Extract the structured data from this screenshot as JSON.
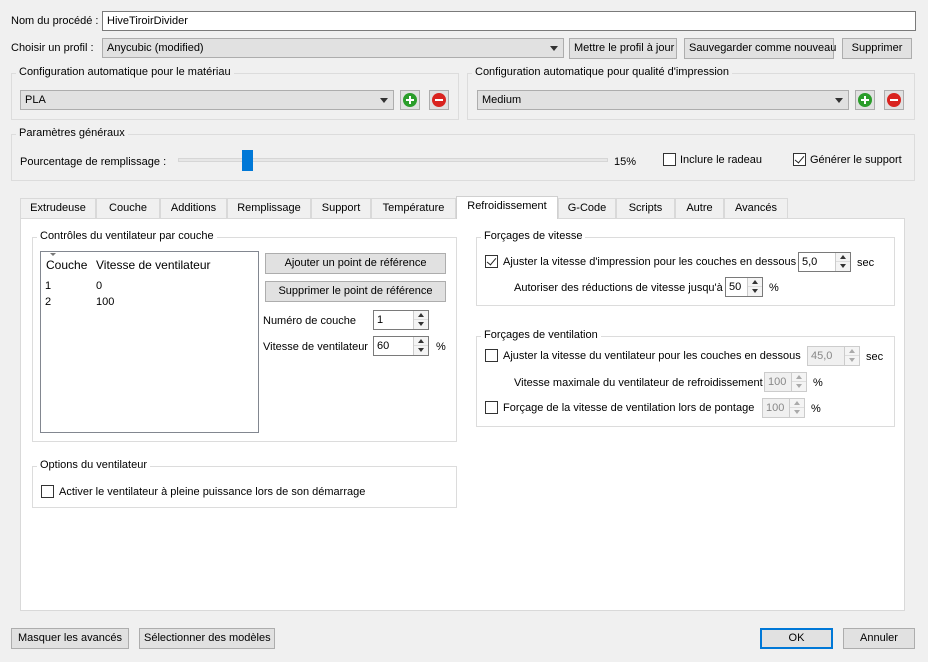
{
  "process": {
    "name_label": "Nom du procédé :",
    "name_value": "HiveTiroirDivider",
    "profile_label": "Choisir un profil :",
    "profile_value": "Anycubic (modified)",
    "update_profile": "Mettre le profil à jour",
    "save_as_new": "Sauvegarder comme nouveau",
    "delete": "Supprimer"
  },
  "material": {
    "title": "Configuration automatique pour le matériau",
    "value": "PLA"
  },
  "quality": {
    "title": "Configuration automatique pour qualité d'impression",
    "value": "Medium"
  },
  "general": {
    "title": "Paramètres généraux",
    "infill_label": "Pourcentage de remplissage :",
    "infill_value": "15%",
    "infill_percent": 15,
    "raft_label": "Inclure le radeau",
    "raft_checked": false,
    "support_label": "Générer le support",
    "support_checked": true
  },
  "tabs": [
    {
      "label": "Extrudeuse"
    },
    {
      "label": "Couche"
    },
    {
      "label": "Additions"
    },
    {
      "label": "Remplissage"
    },
    {
      "label": "Support"
    },
    {
      "label": "Température"
    },
    {
      "label": "Refroidissement",
      "active": true
    },
    {
      "label": "G-Code"
    },
    {
      "label": "Scripts"
    },
    {
      "label": "Autre"
    },
    {
      "label": "Avancés"
    }
  ],
  "fan_controls": {
    "title": "Contrôles du ventilateur par couche",
    "col_layer": "Couche",
    "col_speed": "Vitesse de ventilateur",
    "rows": [
      {
        "layer": "1",
        "speed": "0"
      },
      {
        "layer": "2",
        "speed": "100"
      }
    ],
    "add_point": "Ajouter un point de référence",
    "remove_point": "Supprimer le point de référence",
    "layer_num_label": "Numéro de couche",
    "layer_num_value": "1",
    "fan_speed_label": "Vitesse de ventilateur",
    "fan_speed_value": "60",
    "fan_speed_unit": "%"
  },
  "fan_options": {
    "title": "Options du ventilateur",
    "blip_label": "Activer le ventilateur à pleine puissance lors de son démarrage",
    "blip_checked": false
  },
  "speed_overrides": {
    "title": "Forçages de vitesse",
    "adjust_label": "Ajuster la vitesse d'impression pour les couches en dessous",
    "adjust_checked": true,
    "adjust_value": "5,0",
    "adjust_unit": "sec",
    "allow_label": "Autoriser des réductions de vitesse jusqu'à",
    "allow_value": "50",
    "allow_unit": "%"
  },
  "fan_overrides": {
    "title": "Forçages de ventilation",
    "adjust_label": "Ajuster la vitesse du ventilateur pour les couches en dessous",
    "adjust_checked": false,
    "adjust_value": "45,0",
    "adjust_unit": "sec",
    "max_label": "Vitesse maximale du ventilateur de refroidissement",
    "max_value": "100",
    "max_unit": "%",
    "bridge_label": "Forçage de la vitesse de ventilation lors de pontage",
    "bridge_checked": false,
    "bridge_value": "100",
    "bridge_unit": "%"
  },
  "footer": {
    "hide_advanced": "Masquer les avancés",
    "select_models": "Sélectionner des modèles",
    "ok": "OK",
    "cancel": "Annuler"
  }
}
